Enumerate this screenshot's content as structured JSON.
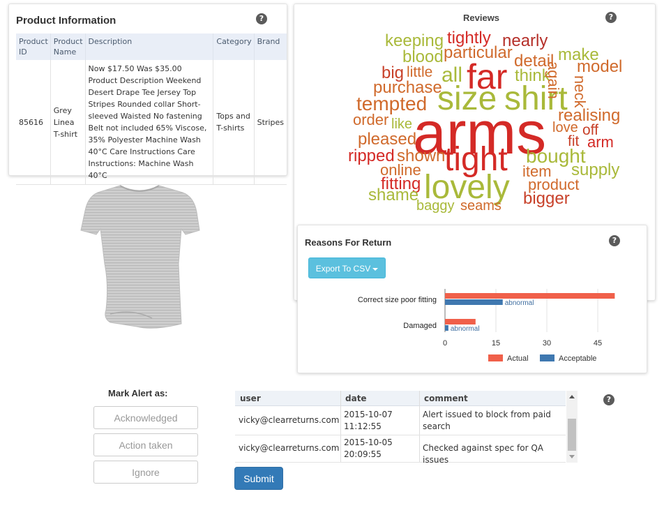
{
  "product_info": {
    "title": "Product Information",
    "columns": [
      "Product ID",
      "Product Name",
      "Description",
      "Category",
      "Brand"
    ],
    "row": {
      "id": "85616",
      "name": "Grey Linea T-shirt",
      "description": "Now $17.50 Was $35.00 Product Description Weekend Desert Drape Tee Jersey Top Stripes Rounded collar Short-sleeved Waisted No fastening Belt not included 65% Viscose, 35% Polyester Machine Wash 40°C Care Instructions Care Instructions: Machine Wash 40°C",
      "category": "Tops and T-shirts",
      "brand": "Stripes"
    },
    "help": "?"
  },
  "reviews": {
    "title": "Reviews",
    "help": "?",
    "words": [
      "arms",
      "far",
      "size",
      "shirt",
      "tight",
      "lovely",
      "keeping",
      "tightly",
      "nearly",
      "blood",
      "particular",
      "detail",
      "make",
      "big",
      "little",
      "all",
      "think",
      "model",
      "purchase",
      "again",
      "neck",
      "tempted",
      "order",
      "like",
      "realising",
      "love",
      "off",
      "pleased",
      "fit",
      "arm",
      "ripped",
      "shown",
      "bought",
      "online",
      "item",
      "supply",
      "fitting",
      "product",
      "shame",
      "bigger",
      "baggy",
      "seams"
    ]
  },
  "returns": {
    "title": "Reasons For Return",
    "help": "?",
    "export_label": "Export To CSV"
  },
  "chart_data": {
    "type": "bar",
    "orientation": "horizontal",
    "categories": [
      "Correct size poor fitting",
      "Damaged"
    ],
    "series": [
      {
        "name": "Actual",
        "values": [
          50,
          9
        ],
        "color": "#f0604a"
      },
      {
        "name": "Acceptable",
        "values": [
          17,
          1
        ],
        "color": "#3f78b0"
      }
    ],
    "data_labels": [
      "abnormal",
      "abnormal"
    ],
    "xticks": [
      0,
      15,
      30,
      45
    ],
    "xlim": [
      0,
      53
    ],
    "legend_position": "bottom",
    "grid": true
  },
  "alerts": {
    "title": "Mark Alert as:",
    "buttons": [
      "Acknowledged",
      "Action taken",
      "Ignore"
    ],
    "help": "?"
  },
  "comments": {
    "columns": [
      "user",
      "date",
      "comment"
    ],
    "rows": [
      {
        "user": "vicky@clearreturns.com",
        "date": "2015-10-07 11:12:55",
        "comment": "Alert issued to block from paid search"
      },
      {
        "user": "vicky@clearreturns.com",
        "date": "2015-10-05 20:09:55",
        "comment": "Checked against spec for QA issues"
      }
    ],
    "submit_label": "Submit"
  }
}
